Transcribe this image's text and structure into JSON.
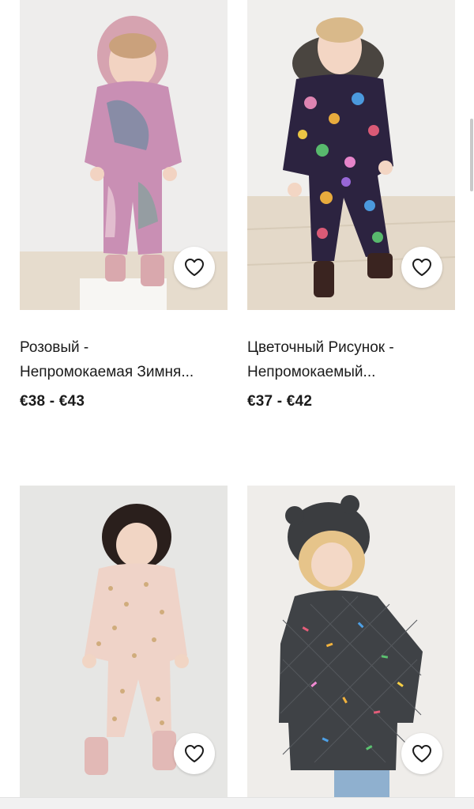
{
  "products": [
    {
      "title_line1": "Розовый -",
      "title_line2": "Непромокаемая Зимня...",
      "price": "€38 - €43",
      "image": "pink-camo-snowsuit-photo",
      "favorite_icon": "heart-outline-icon"
    },
    {
      "title_line1": "Цветочный Рисунок -",
      "title_line2": "Непромокаемый...",
      "price": "€37 - €42",
      "image": "floral-snowsuit-photo",
      "favorite_icon": "heart-outline-icon"
    },
    {
      "image": "pink-metallic-snowsuit-photo",
      "favorite_icon": "heart-outline-icon"
    },
    {
      "image": "charcoal-quilted-jacket-photo",
      "favorite_icon": "heart-outline-icon"
    }
  ],
  "colors": {
    "text": "#1b1b1b",
    "background": "#ffffff",
    "photo_background": "#ecebe9"
  }
}
